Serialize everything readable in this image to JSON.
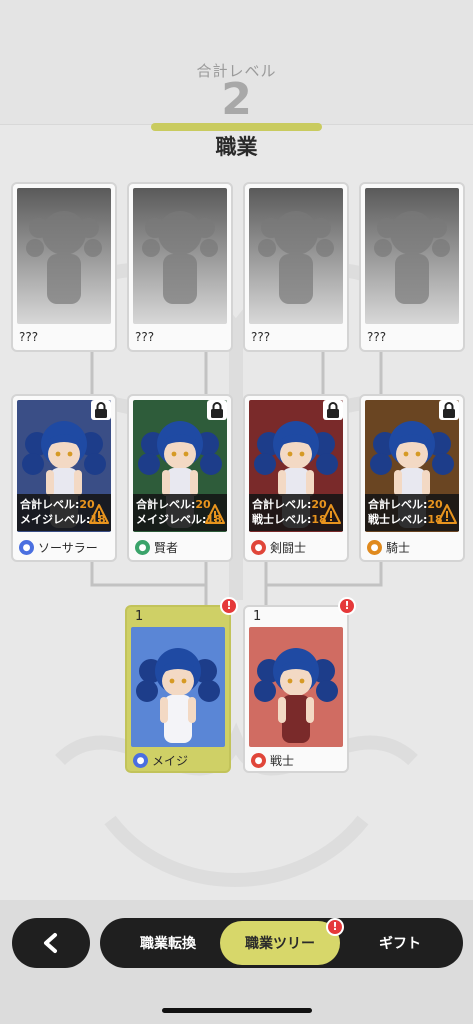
{
  "header": {
    "total_level_label": "合計レベル",
    "total_level_value": "2",
    "section_title": "職業"
  },
  "colors": {
    "accent": "#d7d76a",
    "alert": "#e5393a",
    "warning": "#e8941e"
  },
  "locked_row": [
    {
      "name": "???"
    },
    {
      "name": "???"
    },
    {
      "name": "???"
    },
    {
      "name": "???"
    }
  ],
  "advanced_row": [
    {
      "name": "ソーサラー",
      "icon": "sorcerer-icon",
      "icon_color": "#4a6fe0",
      "bg": "#3a4e86",
      "req1_label": "合計レベル:",
      "req1_value": "20",
      "req2_label": "メイジレベル:",
      "req2_value": "18",
      "locked": true
    },
    {
      "name": "賢者",
      "icon": "sage-icon",
      "icon_color": "#3aa36a",
      "bg": "#2e5c3a",
      "req1_label": "合計レベル:",
      "req1_value": "20",
      "req2_label": "メイジレベル:",
      "req2_value": "18",
      "locked": true
    },
    {
      "name": "剣闘士",
      "icon": "gladiator-icon",
      "icon_color": "#e0463a",
      "bg": "#7a2a2a",
      "req1_label": "合計レベル:",
      "req1_value": "20",
      "req2_label": "戦士レベル:",
      "req2_value": "18",
      "locked": true
    },
    {
      "name": "騎士",
      "icon": "knight-icon",
      "icon_color": "#e08a1e",
      "bg": "#6a4522",
      "req1_label": "合計レベル:",
      "req1_value": "20",
      "req2_label": "戦士レベル:",
      "req2_value": "18",
      "locked": true
    }
  ],
  "base_row": [
    {
      "name": "メイジ",
      "level": "1",
      "icon": "mage-icon",
      "icon_color": "#4a6fe0",
      "selected": true,
      "alert": "!"
    },
    {
      "name": "戦士",
      "level": "1",
      "icon": "warrior-icon",
      "icon_color": "#e0463a",
      "selected": false,
      "alert": "!"
    }
  ],
  "nav": {
    "back_icon": "chevron-left-icon",
    "tabs": [
      {
        "label": "職業転換",
        "active": false
      },
      {
        "label": "職業ツリー",
        "active": true,
        "alert": "!"
      },
      {
        "label": "ギフト",
        "active": false
      }
    ]
  }
}
